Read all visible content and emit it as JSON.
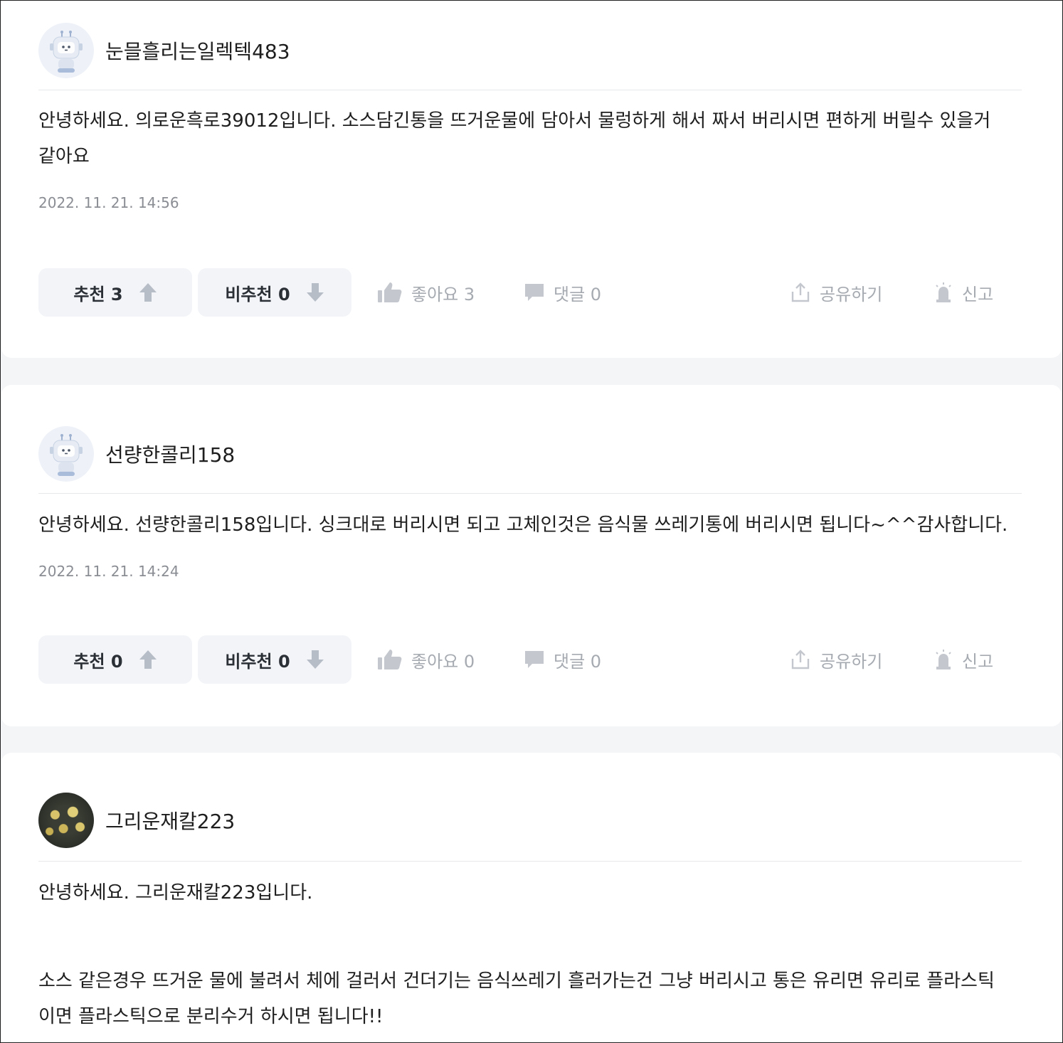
{
  "answers": [
    {
      "username": "눈믈흘리는일렉텍483",
      "avatar": "robot-avatar",
      "body": [
        "안녕하세요. 의로운흑로39012입니다. 소스담긴통을 뜨거운물에 담아서 물렁하게 해서 짜서 버리시면 편하게 버릴수 있을거",
        "같아요"
      ],
      "date": "2022. 11. 21. 14:56",
      "recommend": "추천 3",
      "not_recommend": "비추천 0",
      "like": "좋아요 3",
      "comment": "댓글 0",
      "share": "공유하기",
      "report": "신고"
    },
    {
      "username": "선량한콜리158",
      "avatar": "robot-avatar",
      "body": [
        "안녕하세요. 선량한콜리158입니다. 싱크대로 버리시면 되고 고체인것은 음식물 쓰레기통에 버리시면 됩니다~^^감사합니다."
      ],
      "date": "2022. 11. 21. 14:24",
      "recommend": "추천 0",
      "not_recommend": "비추천 0",
      "like": "좋아요 0",
      "comment": "댓글 0",
      "share": "공유하기",
      "report": "신고"
    },
    {
      "username": "그리운재칼223",
      "avatar": "photo-avatar",
      "body": [
        "안녕하세요. 그리운재칼223입니다.",
        "소스 같은경우 뜨거운 물에 불려서 체에 걸러서 건더기는 음식쓰레기 흘러가는건 그냥 버리시고 통은 유리면 유리로 플라스틱",
        "이면 플라스틱으로 분리수거 하시면 됩니다!!"
      ]
    }
  ],
  "colors": {
    "vote_bg": "#f2f4f8",
    "muted": "#a6aab1",
    "date": "#8a8d93",
    "page_bg": "#f4f5f7"
  }
}
